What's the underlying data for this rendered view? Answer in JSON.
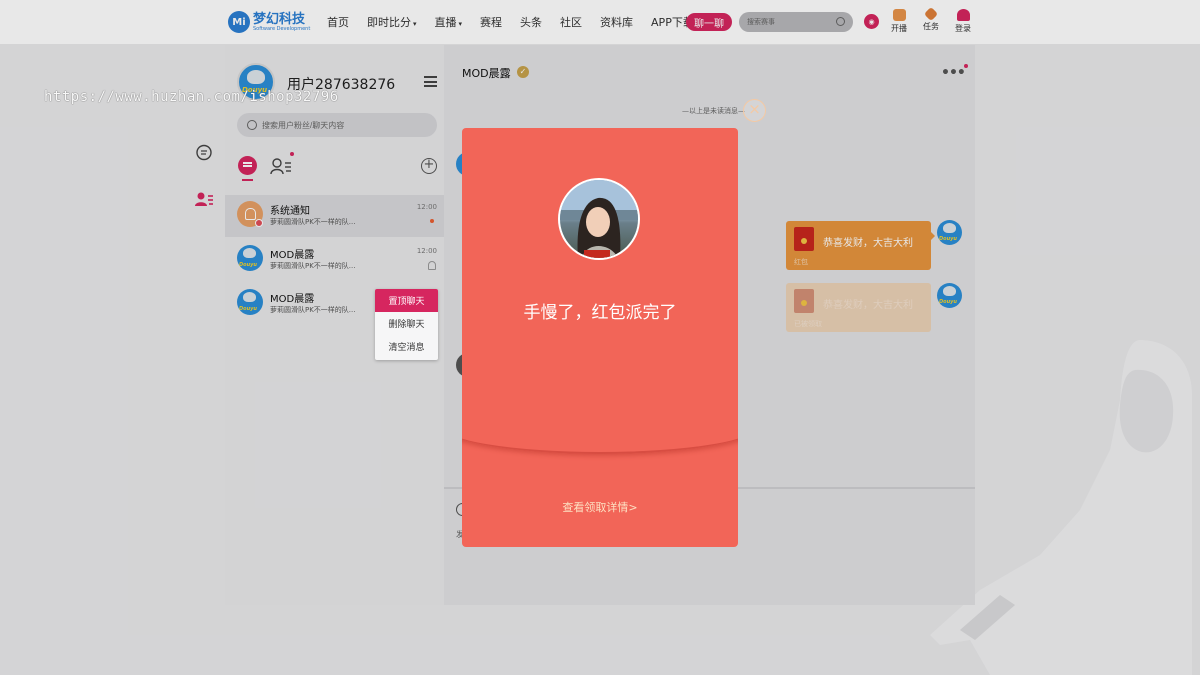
{
  "nav": {
    "logo": {
      "badge": "Mi",
      "name": "梦幻科技",
      "sub": "Software Development"
    },
    "items": [
      {
        "label": "首页",
        "dropdown": false
      },
      {
        "label": "即时比分",
        "dropdown": true
      },
      {
        "label": "直播",
        "dropdown": true
      },
      {
        "label": "赛程",
        "dropdown": false
      },
      {
        "label": "头条",
        "dropdown": false
      },
      {
        "label": "社区",
        "dropdown": false
      },
      {
        "label": "资料库",
        "dropdown": false
      },
      {
        "label": "APP下载",
        "dropdown": false
      }
    ],
    "chat_button": "聊一聊",
    "search_placeholder": "搜索赛事",
    "tools": {
      "broadcast": "开播",
      "tasks": "任务",
      "login": "登录"
    },
    "accent": "#d6265f"
  },
  "watermark": "https://www.huzhan.com/ishop32796",
  "sidebar": {
    "username": "用户287638276",
    "search_placeholder": "搜索用户粉丝/聊天内容",
    "conversations": [
      {
        "name": "系统通知",
        "preview": "萝莉圆滑队PK不一样的队...",
        "time": "12:00",
        "unread_dot": true,
        "avatar": "bell-icon"
      },
      {
        "name": "MOD晨露",
        "preview": "萝莉圆滑队PK不一样的队...",
        "time": "12:00",
        "muted": true,
        "avatar": "douyu"
      },
      {
        "name": "MOD晨露",
        "preview": "萝莉圆滑队PK不一样的队...",
        "time": "",
        "avatar": "douyu"
      }
    ],
    "context_menu": [
      "置顶聊天",
      "删除聊天",
      "清空消息"
    ],
    "douyu_label": "Douyu"
  },
  "chat": {
    "title": "MOD晨露",
    "verified": "✓",
    "unread_divider": "—以上是未读消息—",
    "messages": [
      {
        "type": "redpacket",
        "text": "恭喜发财，大吉大利",
        "footer": "红包",
        "state": "active"
      },
      {
        "type": "redpacket",
        "text": "恭喜发财，大吉大利",
        "footer": "已被领取",
        "state": "opened"
      }
    ],
    "send_hint": "发"
  },
  "modal": {
    "message": "手慢了，红包派完了",
    "link": "查看领取详情>",
    "color": "#f26558"
  }
}
